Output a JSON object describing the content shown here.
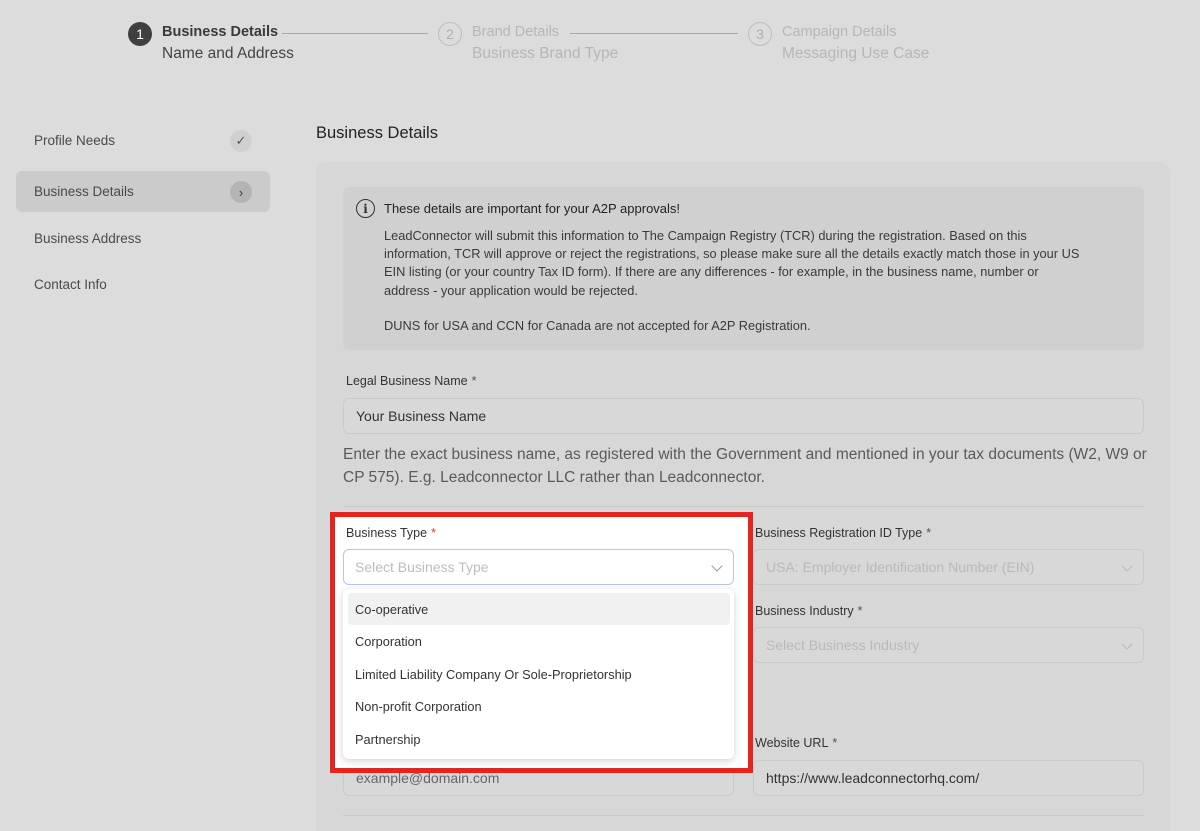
{
  "stepper": [
    {
      "number": "1",
      "title": "Business Details",
      "subtitle": "Name and Address"
    },
    {
      "number": "2",
      "title": "Brand Details",
      "subtitle": "Business Brand Type"
    },
    {
      "number": "3",
      "title": "Campaign Details",
      "subtitle": "Messaging Use Case"
    }
  ],
  "sidebar": {
    "items": [
      {
        "label": "Profile Needs"
      },
      {
        "label": "Business Details"
      },
      {
        "label": "Business Address"
      },
      {
        "label": "Contact Info"
      }
    ]
  },
  "main": {
    "title": "Business Details",
    "info": {
      "icon": "info-icon",
      "title": "These details are important for your A2P approvals!",
      "body": "LeadConnector will submit this information to The Campaign Registry (TCR) during the registration. Based on this information, TCR will approve or reject the registrations, so please make sure all the details exactly match those in your US EIN listing (or your country Tax ID form). If there are any differences - for example, in the business name, number or address - your application would be rejected.",
      "note": "DUNS for USA and CCN for Canada are not accepted for A2P Registration."
    },
    "legal_name": {
      "label": "Legal Business Name",
      "required": "*",
      "value": "Your Business Name",
      "help": "Enter the exact business name, as registered with the Government and mentioned in your tax documents (W2, W9 or CP 575). E.g. Leadconnector LLC rather than Leadconnector."
    },
    "business_type": {
      "label": "Business Type",
      "required": "*",
      "placeholder": "Select Business Type",
      "options": [
        "Co-operative",
        "Corporation",
        "Limited Liability Company Or Sole-Proprietorship",
        "Non-profit Corporation",
        "Partnership"
      ]
    },
    "registration_id_type": {
      "label": "Business Registration ID Type",
      "required": "*",
      "value": "USA: Employer Identification Number (EIN)"
    },
    "industry": {
      "label": "Business Industry",
      "required": "*",
      "placeholder": "Select Business Industry"
    },
    "email": {
      "placeholder": "example@domain.com"
    },
    "website": {
      "label": "Website URL",
      "required": "*",
      "value": "https://www.leadconnectorhq.com/"
    }
  },
  "colors": {
    "highlight": "#e52420",
    "overlay": "#dcdcdc",
    "required_star": "#e53935"
  }
}
